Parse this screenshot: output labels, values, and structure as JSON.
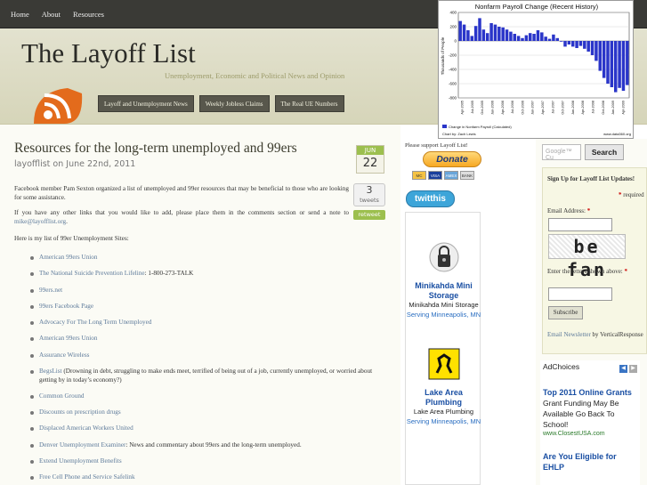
{
  "nav": {
    "home": "Home",
    "about": "About",
    "resources": "Resources"
  },
  "site": {
    "title": "The Layoff List",
    "tagline": "Unemployment, Economic and Political News and Opinion"
  },
  "categories": [
    "Layoff and Unemployment News",
    "Weekly Jobless Claims",
    "The Real UE Numbers"
  ],
  "post": {
    "title": "Resources for the long-term unemployed and 99ers",
    "meta": "layofflist on June 22nd, 2011",
    "date_month": "JUN",
    "date_day": "22",
    "tweets_count": "3",
    "tweets_label": "tweets",
    "retweet": "retweet",
    "p1": "Facebook member Pam Sexton organized a list of unemployed and 99er resources that may be beneficial to those who are looking for some assistance.",
    "p2_before": "If you have any other links that you would like to add, please place them in the comments section or send a note to ",
    "p2_link": "mike@layofflist.org",
    "p2_after": ".",
    "p3": "Here is my list of 99er Unemployment Sites:",
    "links": [
      {
        "link": "American 99ers Union",
        "rest": ""
      },
      {
        "link": "The National Suicide Prevention Lifeline",
        "rest": ": 1-800-273-TALK"
      },
      {
        "link": "99ers.net",
        "rest": ""
      },
      {
        "link": "99ers Facebook Page",
        "rest": ""
      },
      {
        "link": "Advocacy For The Long Term Unemployed",
        "rest": ""
      },
      {
        "link": "American 99ers Union",
        "rest": ""
      },
      {
        "link": "Assurance Wireless",
        "rest": ""
      },
      {
        "link": "BegsList",
        "rest": " (Drowning in debt, struggling to make ends meet, terrified of being out of a job, currently unemployed, or worried about getting by in today’s economy?)"
      },
      {
        "link": "Common Ground",
        "rest": ""
      },
      {
        "link": "Discounts on prescription drugs",
        "rest": ""
      },
      {
        "link": "Displaced American Workers United",
        "rest": ""
      },
      {
        "link": "Denver Unemployment Examiner",
        "rest": ": News and commentary about 99ers and the long-term unemployed."
      },
      {
        "link": "Extend Unemployment Benefits",
        "rest": ""
      },
      {
        "link": "Free Cell Phone and Service Safelink",
        "rest": ""
      }
    ]
  },
  "support": {
    "label": "Please support Layoff List!",
    "donate": "Donate",
    "cards": [
      "MC",
      "VISA",
      "AMEX",
      "BANK"
    ],
    "twitthis": "twitthis"
  },
  "ads_left": [
    {
      "name": "Minikahda Mini Storage",
      "sub": "Minikahda Mini Storage",
      "loc": "Serving Minneapolis, MN"
    },
    {
      "name": "Lake Area Plumbing",
      "sub": "Lake Area Plumbing",
      "loc": "Serving Minneapolis, MN"
    }
  ],
  "search": {
    "placeholder": "Google™ Cu",
    "button": "Search"
  },
  "signup": {
    "heading": "Sign Up for Layoff List Updates!",
    "required": "required",
    "email_label": "Email Address:",
    "captcha_text": "be fan",
    "captcha_label": "Enter the letters shown above:",
    "submit": "Subscribe",
    "foot_link": "Email Newsletter",
    "foot_rest": " by VerticalResponse"
  },
  "adchoices": {
    "label": "AdChoices",
    "title1": "Top 2011 Online Grants",
    "desc1": "Grant Funding May Be Available Go Back To School!",
    "url1": "www.ClosestUSA.com",
    "title2": "Are You Eligible for EHLP"
  },
  "chart_data": {
    "type": "bar",
    "title": "Nonfarm Payroll Change (Recent History)",
    "ylabel": "Thousands of People",
    "ylim": [
      -800,
      400
    ],
    "yticks": [
      400,
      200,
      0,
      -200,
      -400,
      -600,
      -800
    ],
    "categories": [
      "Apr-2005",
      "Jul-2005",
      "Oct-2005",
      "Jan-2006",
      "Apr-2006",
      "Jul-2006",
      "Oct-2006",
      "Jan-2007",
      "Apr-2007",
      "Jul-2007",
      "Oct-2007",
      "Jan-2008",
      "Apr-2008",
      "Jul-2008",
      "Oct-2008",
      "Jan-2009",
      "Apr-2009"
    ],
    "values": [
      280,
      230,
      150,
      70,
      210,
      320,
      160,
      110,
      250,
      230,
      200,
      190,
      160,
      130,
      100,
      70,
      40,
      80,
      110,
      100,
      150,
      120,
      60,
      30,
      90,
      40,
      -10,
      -80,
      -50,
      -80,
      -100,
      -70,
      -110,
      -150,
      -200,
      -280,
      -420,
      -520,
      -600,
      -650,
      -720,
      -660,
      -700,
      -620
    ],
    "series": [
      {
        "name": "Change in Nonfarm Payroll (Calculated)"
      }
    ],
    "credit_left": "Chart by: Zach Lewis",
    "credit_right": "www.data360.org"
  },
  "colors": {
    "accent": "#9cbf4e",
    "bar": "#2a35c9",
    "nav": "#3a3a36"
  }
}
